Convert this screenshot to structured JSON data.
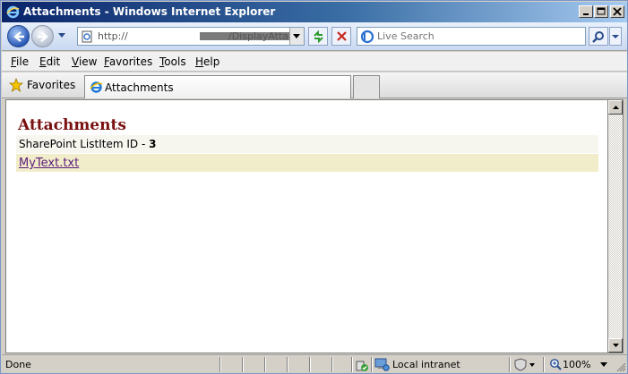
{
  "window": {
    "title": "Attachments - Windows Internet Explorer"
  },
  "address": {
    "prefix": "http://",
    "suffix": "/DisplayAttach"
  },
  "search": {
    "placeholder": "Live Search"
  },
  "menu": {
    "items": [
      {
        "label": "File",
        "u": "F",
        "rest": "ile"
      },
      {
        "label": "Edit",
        "u": "E",
        "rest": "dit"
      },
      {
        "label": "View",
        "u": "V",
        "rest": "iew"
      },
      {
        "label": "Favorites",
        "u": "F",
        "rest": "avorites"
      },
      {
        "label": "Tools",
        "u": "T",
        "rest": "ools"
      },
      {
        "label": "Help",
        "u": "H",
        "rest": "elp"
      }
    ]
  },
  "favorites": {
    "label": "Favorites"
  },
  "tab": {
    "label": "Attachments"
  },
  "page": {
    "title": "Attachments",
    "id_label": "SharePoint ListItem ID - ",
    "id_value": "3",
    "file_link": "MyText.txt"
  },
  "status": {
    "text": "Done",
    "zone": "Local intranet",
    "zoom": "100%"
  },
  "colors": {
    "title_color": "#7a1010",
    "link_color": "#5a1b7a",
    "row_id_bg": "#f6f5ee",
    "row_file_bg": "#f1edca"
  }
}
